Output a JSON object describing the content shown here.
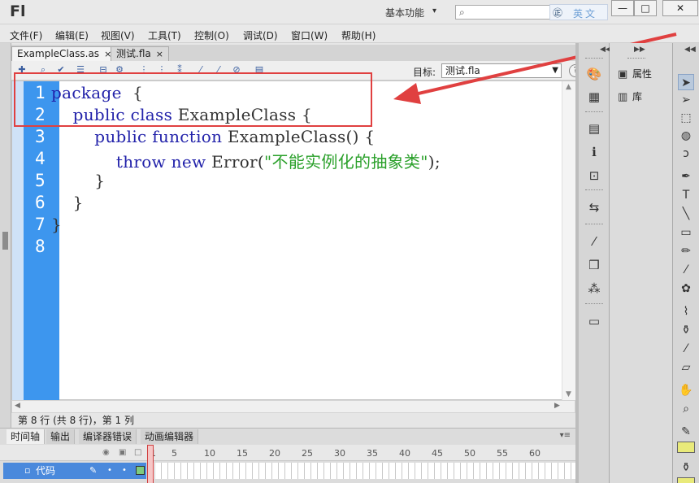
{
  "app": {
    "logo": "Fl",
    "workspace": "基本功能",
    "workspace_caret": "▾"
  },
  "search": {
    "placeholder": ""
  },
  "ime": {
    "logo": "㊣",
    "text": "英文"
  },
  "window_controls": {
    "minimize": "—",
    "maximize": "□",
    "close": "✕"
  },
  "menu": [
    {
      "label": "文件(F)"
    },
    {
      "label": "编辑(E)"
    },
    {
      "label": "视图(V)"
    },
    {
      "label": "工具(T)"
    },
    {
      "label": "控制(O)"
    },
    {
      "label": "调试(D)"
    },
    {
      "label": "窗口(W)"
    },
    {
      "label": "帮助(H)"
    }
  ],
  "tabs": [
    {
      "label": "ExampleClass.as",
      "close": "×"
    },
    {
      "label": "测试.fla",
      "close": "×"
    }
  ],
  "toolbar": {
    "target_label": "目标:",
    "target_value": "测试.fla",
    "help": "?",
    "icons": [
      "add-statement",
      "find",
      "check-syntax",
      "auto-format",
      "code-hint",
      "debug-options",
      "collapse-between-braces",
      "collapse-selection",
      "expand-all",
      "apply-block-comment",
      "apply-line-comment",
      "remove-comment",
      "show-hide-toolbox",
      "code-snippets"
    ]
  },
  "editor": {
    "line_numbers": [
      "1",
      "2",
      "3",
      "4",
      "5",
      "6",
      "7",
      "8"
    ],
    "lines": [
      {
        "kw": "package",
        "rest": "  {"
      },
      {
        "indent": "    ",
        "kw": "public class",
        "rest": " ExampleClass {"
      },
      {
        "indent": "        ",
        "kw": "public function",
        "rest": " ExampleClass() {"
      },
      {
        "indent": "            ",
        "kw": "throw new",
        "rest": " Error(",
        "str": "\"不能实例化的抽象类\"",
        "tail": ");"
      },
      {
        "indent": "        ",
        "rest": "}"
      },
      {
        "indent": "    ",
        "rest": "}"
      },
      {
        "rest": "}"
      },
      {
        "rest": ""
      }
    ]
  },
  "status": {
    "text": "第 8 行 (共 8 行)，第 1 列"
  },
  "bottom": {
    "tabs": [
      "时间轴",
      "输出",
      "编译器错误",
      "动画编辑器"
    ],
    "frame_numbers": [
      "1",
      "5",
      "10",
      "15",
      "20",
      "25",
      "30",
      "35",
      "40",
      "45",
      "50",
      "55",
      "60"
    ],
    "layer": {
      "name": "代码"
    }
  },
  "panels": {
    "properties": "属性",
    "library": "库"
  },
  "colors": {
    "accent": "#3d96ee",
    "highlight": "#e04040",
    "string": "#2aa02a",
    "keyword": "#2222aa"
  }
}
